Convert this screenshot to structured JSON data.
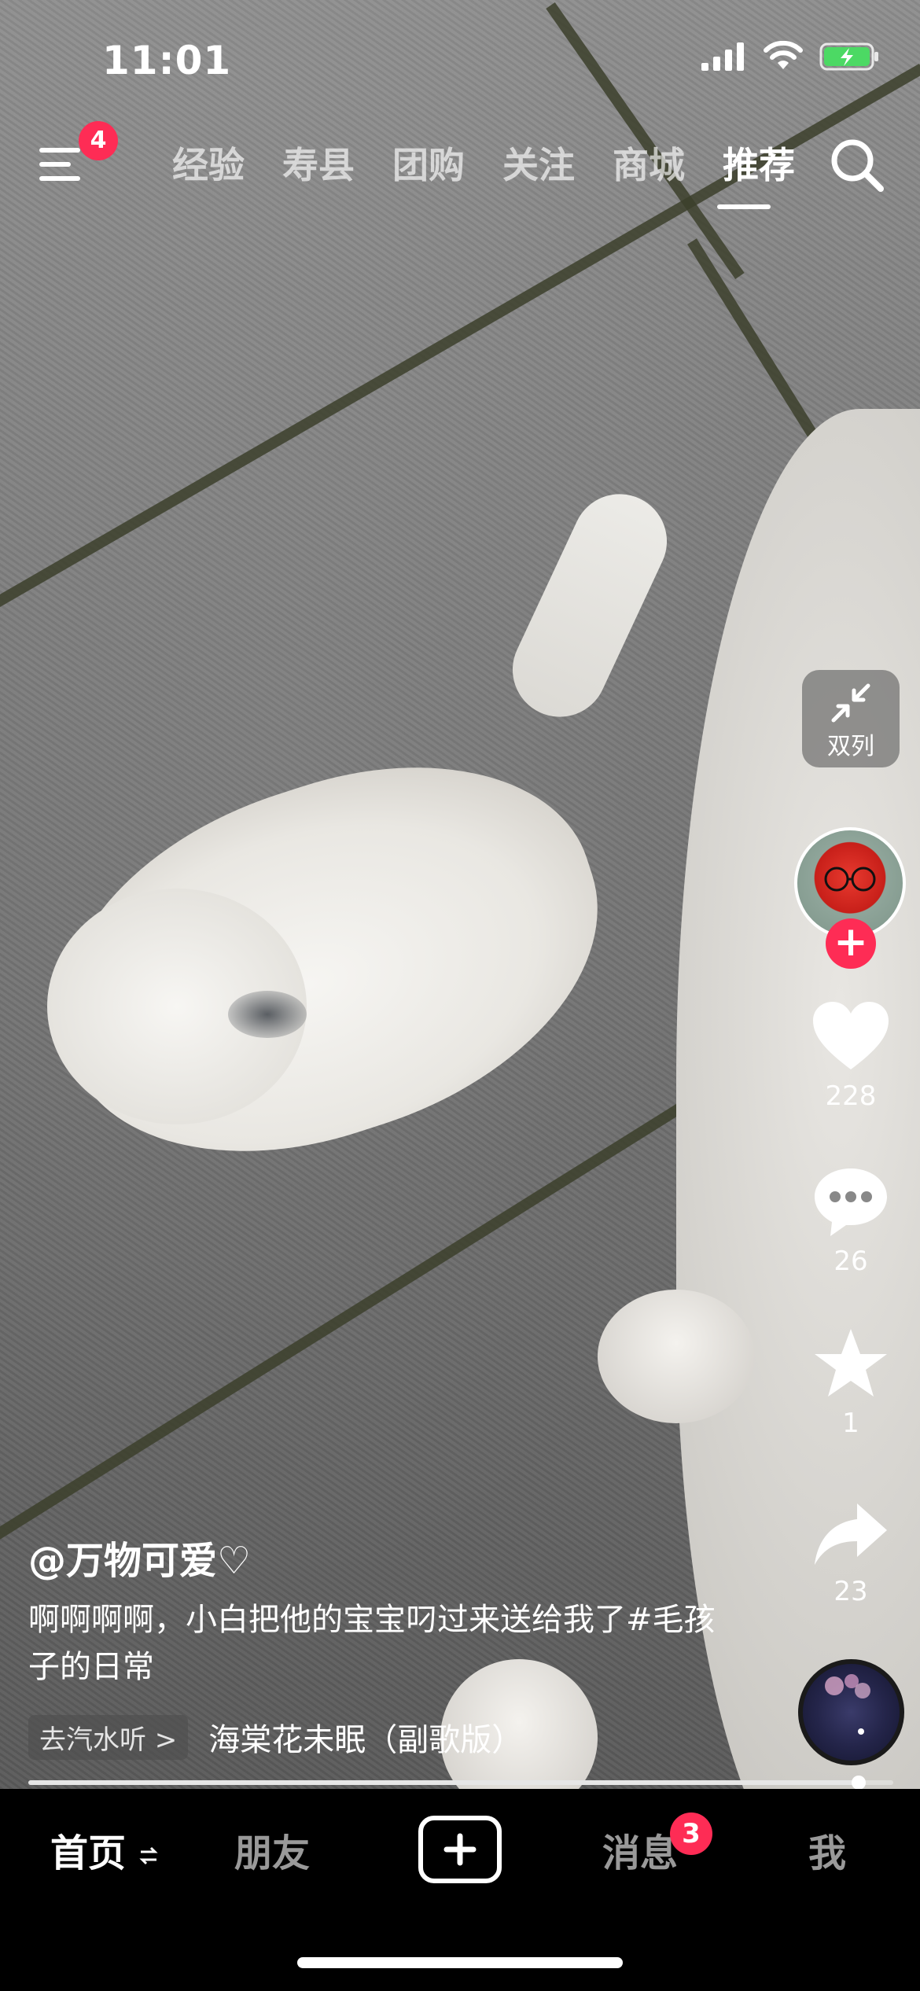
{
  "status_bar": {
    "time": "11:01"
  },
  "top_nav": {
    "menu_badge": "4",
    "tabs": [
      "经验",
      "寿县",
      "团购",
      "关注",
      "商城",
      "推荐"
    ],
    "active_tab": "推荐"
  },
  "right_rail": {
    "split_label": "双列",
    "like_count": "228",
    "comment_count": "26",
    "favorite_count": "1",
    "share_count": "23"
  },
  "caption": {
    "author": "@万物可爱♡",
    "description": "啊啊啊啊，小白把他的宝宝叼过来送给我了#毛孩子的日常",
    "music_tag": "去汽水听 >",
    "music_name": "海棠花未眠（副歌版）"
  },
  "progress": {
    "fraction": 0.96
  },
  "bottom_nav": {
    "home": "首页",
    "friends": "朋友",
    "messages": "消息",
    "messages_badge": "3",
    "me": "我"
  },
  "colors": {
    "accent": "#fe2c55",
    "bar": "#000000"
  }
}
